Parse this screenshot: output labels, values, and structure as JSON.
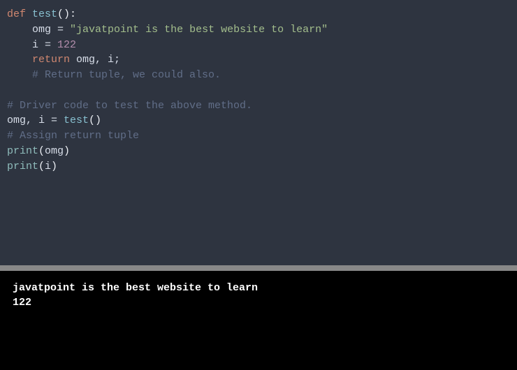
{
  "code": {
    "l1_def": "def",
    "l1_fn": "test",
    "l1_paren": "():",
    "l2_var": "omg",
    "l2_eq": " = ",
    "l2_str": "\"javatpoint is the best website to learn\"",
    "l3_var": "i",
    "l3_eq": " = ",
    "l3_num": "122",
    "l4_ret": "return",
    "l4_vars": " omg, i;",
    "l5_cmt": "# Return tuple, we could also.",
    "l7_cmt": "# Driver code to test the above method.",
    "l8_lhs": "omg, i = ",
    "l8_fn": "test",
    "l8_paren": "()",
    "l9_cmt": "# Assign return tuple",
    "l10_print": "print",
    "l10_open": "(",
    "l10_arg": "omg",
    "l10_close": ")",
    "l11_print": "print",
    "l11_open": "(",
    "l11_arg": "i",
    "l11_close": ")"
  },
  "output": {
    "line1": "javatpoint is the best website to learn",
    "line2": "122"
  }
}
